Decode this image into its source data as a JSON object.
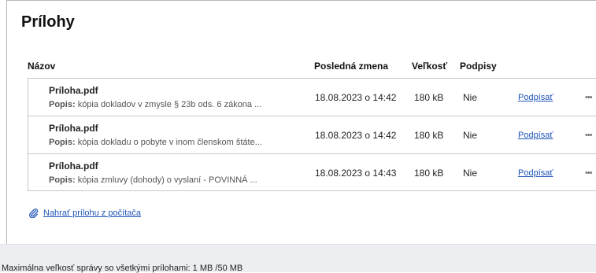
{
  "title": "Prílohy",
  "columns": {
    "name": "Názov",
    "modified": "Posledná zmena",
    "size": "Veľkosť",
    "signatures": "Podpisy"
  },
  "attachments": [
    {
      "file": "Príloha.pdf",
      "desc_label": "Popis:",
      "desc": "kópia dokladov v zmysle § 23b ods. 6 zákona ...",
      "modified": "18.08.2023 o 14:42",
      "size": "180 kB",
      "signed": "Nie",
      "action": "Podpísať",
      "more": "•••"
    },
    {
      "file": "Príloha.pdf",
      "desc_label": "Popis:",
      "desc": "kópia dokladu o pobyte v inom členskom štáte...",
      "modified": "18.08.2023 o 14:42",
      "size": "180 kB",
      "signed": "Nie",
      "action": "Podpísať",
      "more": "•••"
    },
    {
      "file": "Príloha.pdf",
      "desc_label": "Popis:",
      "desc": "kópia zmluvy (dohody) o vyslaní - POVINNÁ ...",
      "modified": "18.08.2023 o 14:43",
      "size": "180 kB",
      "signed": "Nie",
      "action": "Podpísať",
      "more": "•••"
    }
  ],
  "upload_label": "Nahrať prílohu z počítača",
  "upload_icon": "paperclip-icon",
  "footer_text": "Maximálna veľkosť správy so všetkými prílohami: 1 MB /50 MB",
  "colors": {
    "link": "#1f55b8",
    "footer_bg": "#eceef2"
  }
}
